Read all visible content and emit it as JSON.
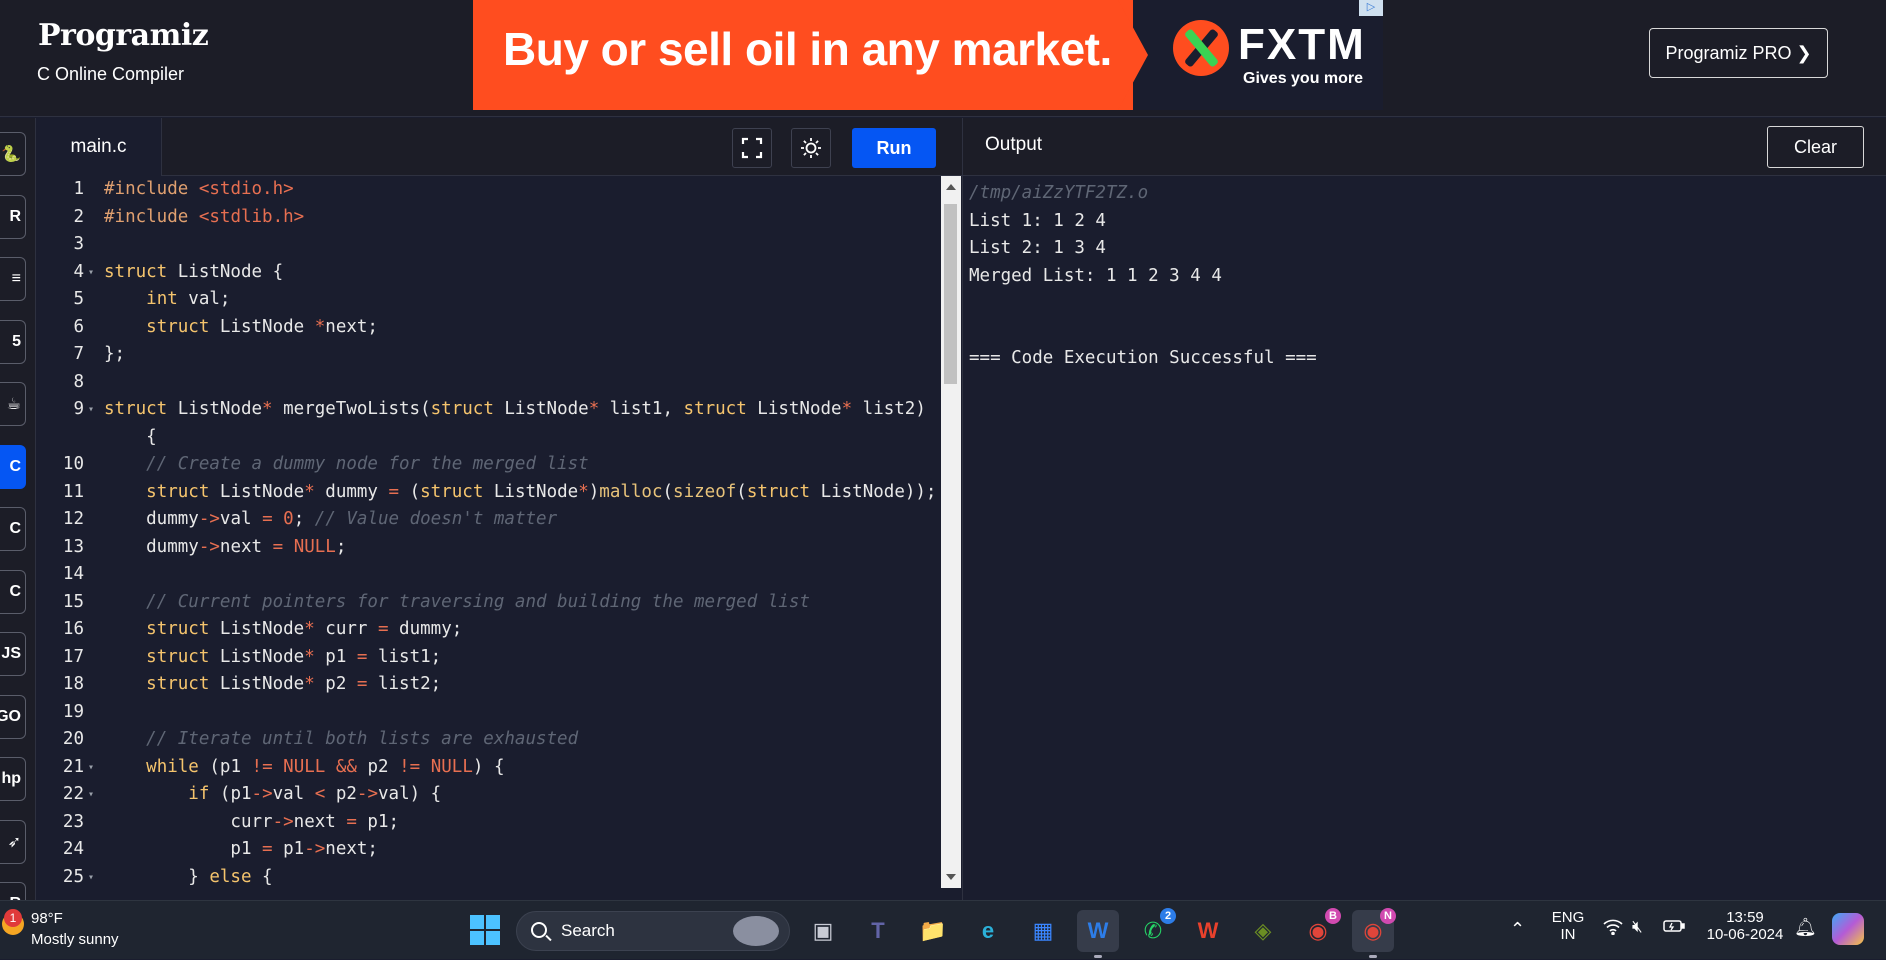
{
  "header": {
    "brand": "Programiz",
    "subtitle": "C Online Compiler",
    "pro_button": "Programiz PRO ❯"
  },
  "ad": {
    "headline": "Buy or sell oil in any market.",
    "brand": "FXTM",
    "tagline": "Gives you more"
  },
  "sidebar": {
    "languages": [
      {
        "name": "python-icon",
        "glyph": "🐍"
      },
      {
        "name": "r-icon",
        "glyph": "R"
      },
      {
        "name": "sql-icon",
        "glyph": "≡"
      },
      {
        "name": "html-icon",
        "glyph": "5"
      },
      {
        "name": "java-icon",
        "glyph": "☕"
      },
      {
        "name": "c-icon",
        "glyph": "C"
      },
      {
        "name": "cpp-icon",
        "glyph": "C"
      },
      {
        "name": "csharp-icon",
        "glyph": "C"
      },
      {
        "name": "javascript-icon",
        "glyph": "JS"
      },
      {
        "name": "go-icon",
        "glyph": "GO"
      },
      {
        "name": "php-icon",
        "glyph": "hp"
      },
      {
        "name": "swift-icon",
        "glyph": "➶"
      },
      {
        "name": "rust-icon",
        "glyph": "R"
      }
    ]
  },
  "editor": {
    "file_tab": "main.c",
    "run_label": "Run"
  },
  "code": {
    "lines": [
      {
        "n": "1",
        "fold": "",
        "html": "<span class=\"pp\">#include</span> <span class=\"str\">&lt;stdio.h&gt;</span>"
      },
      {
        "n": "2",
        "fold": "",
        "html": "<span class=\"pp\">#include</span> <span class=\"str\">&lt;stdlib.h&gt;</span>"
      },
      {
        "n": "3",
        "fold": "",
        "html": ""
      },
      {
        "n": "4",
        "fold": "▾",
        "html": "<span class=\"kw\">struct</span> ListNode {"
      },
      {
        "n": "5",
        "fold": "",
        "html": "    <span class=\"kw\">int</span> val;"
      },
      {
        "n": "6",
        "fold": "",
        "html": "    <span class=\"kw\">struct</span> ListNode <span class=\"op\">*</span>next;"
      },
      {
        "n": "7",
        "fold": "",
        "html": "};"
      },
      {
        "n": "8",
        "fold": "",
        "html": ""
      },
      {
        "n": "9",
        "fold": "▾",
        "html": "<span class=\"kw\">struct</span> ListNode<span class=\"op\">*</span> mergeTwoLists(<span class=\"kw\">struct</span> ListNode<span class=\"op\">*</span> list1, <span class=\"kw\">struct</span> ListNode<span class=\"op\">*</span> list2)"
      },
      {
        "n": "",
        "fold": "",
        "html": "    {"
      },
      {
        "n": "10",
        "fold": "",
        "html": "    <span class=\"cm\">// Create a dummy node for the merged list</span>"
      },
      {
        "n": "11",
        "fold": "",
        "html": "    <span class=\"kw\">struct</span> ListNode<span class=\"op\">*</span> dummy <span class=\"op\">=</span> (<span class=\"kw\">struct</span> ListNode<span class=\"op\">*</span>)<span class=\"fn\">malloc</span>(<span class=\"fn\">sizeof</span>(<span class=\"kw\">struct</span> ListNode));"
      },
      {
        "n": "12",
        "fold": "",
        "html": "    dummy<span class=\"op\">-&gt;</span>val <span class=\"op\">=</span> <span class=\"num\">0</span>; <span class=\"cm\">// Value doesn't matter</span>"
      },
      {
        "n": "13",
        "fold": "",
        "html": "    dummy<span class=\"op\">-&gt;</span>next <span class=\"op\">=</span> <span class=\"num\">NULL</span>;"
      },
      {
        "n": "14",
        "fold": "",
        "html": ""
      },
      {
        "n": "15",
        "fold": "",
        "html": "    <span class=\"cm\">// Current pointers for traversing and building the merged list</span>"
      },
      {
        "n": "16",
        "fold": "",
        "html": "    <span class=\"kw\">struct</span> ListNode<span class=\"op\">*</span> curr <span class=\"op\">=</span> dummy;"
      },
      {
        "n": "17",
        "fold": "",
        "html": "    <span class=\"kw\">struct</span> ListNode<span class=\"op\">*</span> p1 <span class=\"op\">=</span> list1;"
      },
      {
        "n": "18",
        "fold": "",
        "html": "    <span class=\"kw\">struct</span> ListNode<span class=\"op\">*</span> p2 <span class=\"op\">=</span> list2;"
      },
      {
        "n": "19",
        "fold": "",
        "html": ""
      },
      {
        "n": "20",
        "fold": "",
        "html": "    <span class=\"cm\">// Iterate until both lists are exhausted</span>"
      },
      {
        "n": "21",
        "fold": "▾",
        "html": "    <span class=\"kw\">while</span> (p1 <span class=\"op\">!=</span> <span class=\"num\">NULL</span> <span class=\"op\">&amp;&amp;</span> p2 <span class=\"op\">!=</span> <span class=\"num\">NULL</span>) {"
      },
      {
        "n": "22",
        "fold": "▾",
        "html": "        <span class=\"kw\">if</span> (p1<span class=\"op\">-&gt;</span>val <span class=\"op\">&lt;</span> p2<span class=\"op\">-&gt;</span>val) {"
      },
      {
        "n": "23",
        "fold": "",
        "html": "            curr<span class=\"op\">-&gt;</span>next <span class=\"op\">=</span> p1;"
      },
      {
        "n": "24",
        "fold": "",
        "html": "            p1 <span class=\"op\">=</span> p1<span class=\"op\">-&gt;</span>next;"
      },
      {
        "n": "25",
        "fold": "▾",
        "html": "        } <span class=\"kw\">else</span> {"
      }
    ]
  },
  "output": {
    "title": "Output",
    "clear_label": "Clear",
    "path": "/tmp/aiZzYTF2TZ.o",
    "lines": [
      "List 1: 1 2 4",
      "List 2: 1 3 4",
      "Merged List: 1 1 2 3 4 4",
      "",
      "",
      "=== Code Execution Successful ==="
    ]
  },
  "taskbar": {
    "weather_badge": "1",
    "temperature": "98°F",
    "condition": "Mostly sunny",
    "search_label": "Search",
    "apps": [
      {
        "name": "task-view-icon",
        "glyph": "▣",
        "color": "#c8cbd4",
        "badge": "",
        "active": false
      },
      {
        "name": "teams-icon",
        "glyph": "T",
        "color": "#6264a7",
        "badge": "",
        "active": false
      },
      {
        "name": "file-explorer-icon",
        "glyph": "📁",
        "color": "#f5c542",
        "badge": "",
        "active": false
      },
      {
        "name": "edge-icon",
        "glyph": "e",
        "color": "#2bb0d8",
        "badge": "",
        "active": false
      },
      {
        "name": "microsoft-store-icon",
        "glyph": "▦",
        "color": "#3a86ff",
        "badge": "",
        "active": false
      },
      {
        "name": "webex-icon",
        "glyph": "W",
        "color": "#2d7de8",
        "badge": "",
        "active": true
      },
      {
        "name": "whatsapp-icon",
        "glyph": "✆",
        "color": "#25d366",
        "badge": "2",
        "active": false
      },
      {
        "name": "wps-office-icon",
        "glyph": "W",
        "color": "#e8412c",
        "badge": "",
        "active": false
      },
      {
        "name": "sticky-app-icon",
        "glyph": "◈",
        "color": "#6b8e23",
        "badge": "",
        "active": false
      },
      {
        "name": "chrome-profile-b-icon",
        "glyph": "◉",
        "color": "#e0453a",
        "badge": "B",
        "active": false
      },
      {
        "name": "chrome-profile-n-icon",
        "glyph": "◉",
        "color": "#e0453a",
        "badge": "N",
        "active": true
      }
    ],
    "language_line1": "ENG",
    "language_line2": "IN",
    "time": "13:59",
    "date": "10-06-2024"
  }
}
